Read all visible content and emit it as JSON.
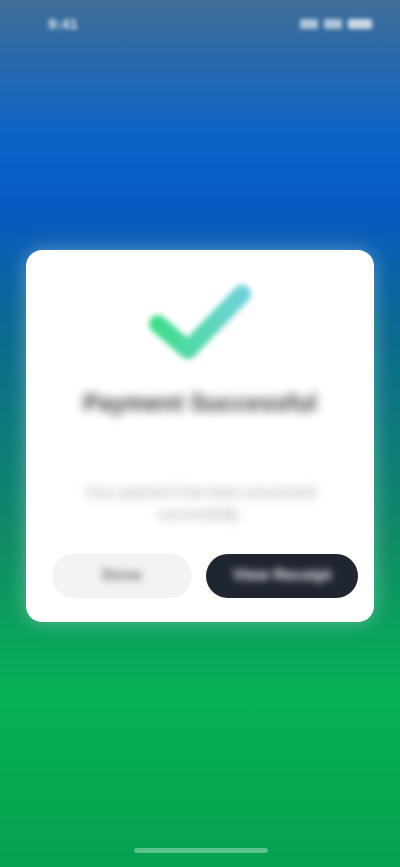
{
  "status_bar": {
    "time": "9:41"
  },
  "dialog": {
    "icon": "check-icon",
    "icon_colors": {
      "start": "#3fdc8a",
      "end": "#6ed2d9"
    },
    "title": "Payment Successful",
    "message": "Your payment has been processed successfully.",
    "secondary_button": "Done",
    "primary_button": "View Receipt"
  },
  "colors": {
    "background_top": "#0b63c8",
    "background_bottom": "#06b155",
    "primary_button": "#1f2531"
  }
}
